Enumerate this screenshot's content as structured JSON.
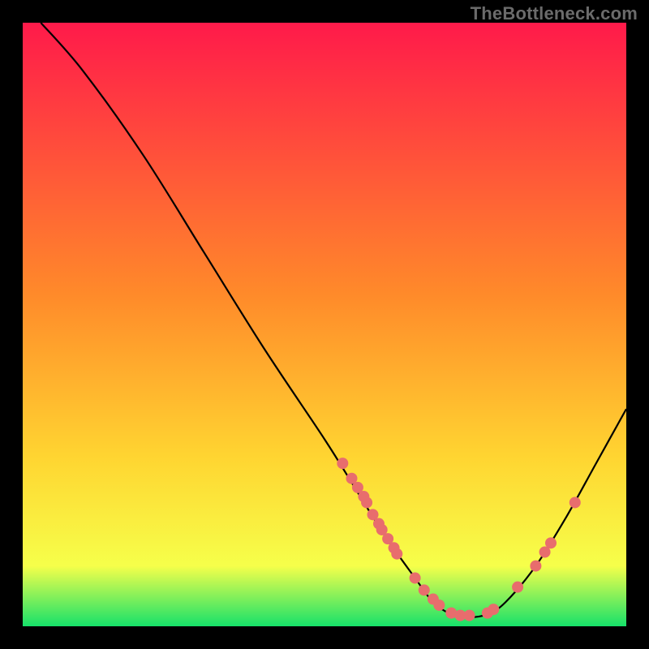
{
  "watermark": "TheBottleneck.com",
  "chart_data": {
    "type": "line",
    "title": "",
    "xlabel": "",
    "ylabel": "",
    "xlim": [
      0,
      100
    ],
    "ylim": [
      0,
      100
    ],
    "gradient_top": "#ff1a4a",
    "gradient_mid": "#ffd531",
    "gradient_bottom": "#16e16a",
    "curve": [
      {
        "x": 3.0,
        "y": 100.0
      },
      {
        "x": 10.0,
        "y": 92.0
      },
      {
        "x": 20.0,
        "y": 78.0
      },
      {
        "x": 30.0,
        "y": 62.0
      },
      {
        "x": 40.0,
        "y": 46.0
      },
      {
        "x": 50.0,
        "y": 31.0
      },
      {
        "x": 55.0,
        "y": 23.0
      },
      {
        "x": 60.0,
        "y": 15.0
      },
      {
        "x": 65.0,
        "y": 8.0
      },
      {
        "x": 68.0,
        "y": 4.0
      },
      {
        "x": 71.0,
        "y": 2.0
      },
      {
        "x": 74.0,
        "y": 1.5
      },
      {
        "x": 77.0,
        "y": 2.0
      },
      {
        "x": 80.0,
        "y": 4.0
      },
      {
        "x": 85.0,
        "y": 10.0
      },
      {
        "x": 90.0,
        "y": 18.0
      },
      {
        "x": 95.0,
        "y": 27.0
      },
      {
        "x": 100.0,
        "y": 36.0
      }
    ],
    "markers": [
      {
        "x": 53.0,
        "y": 27.0
      },
      {
        "x": 54.5,
        "y": 24.5
      },
      {
        "x": 55.5,
        "y": 23.0
      },
      {
        "x": 56.5,
        "y": 21.5
      },
      {
        "x": 57.0,
        "y": 20.5
      },
      {
        "x": 58.0,
        "y": 18.5
      },
      {
        "x": 59.0,
        "y": 17.0
      },
      {
        "x": 59.5,
        "y": 16.0
      },
      {
        "x": 60.5,
        "y": 14.5
      },
      {
        "x": 61.5,
        "y": 13.0
      },
      {
        "x": 62.0,
        "y": 12.0
      },
      {
        "x": 65.0,
        "y": 8.0
      },
      {
        "x": 66.5,
        "y": 6.0
      },
      {
        "x": 68.0,
        "y": 4.5
      },
      {
        "x": 69.0,
        "y": 3.5
      },
      {
        "x": 71.0,
        "y": 2.2
      },
      {
        "x": 72.5,
        "y": 1.8
      },
      {
        "x": 74.0,
        "y": 1.8
      },
      {
        "x": 77.0,
        "y": 2.2
      },
      {
        "x": 78.0,
        "y": 2.8
      },
      {
        "x": 82.0,
        "y": 6.5
      },
      {
        "x": 85.0,
        "y": 10.0
      },
      {
        "x": 86.5,
        "y": 12.3
      },
      {
        "x": 87.5,
        "y": 13.8
      },
      {
        "x": 91.5,
        "y": 20.5
      }
    ],
    "marker_color": "#e86d6d",
    "marker_radius": 7,
    "curve_stroke": "#000000",
    "curve_width": 2.2
  }
}
